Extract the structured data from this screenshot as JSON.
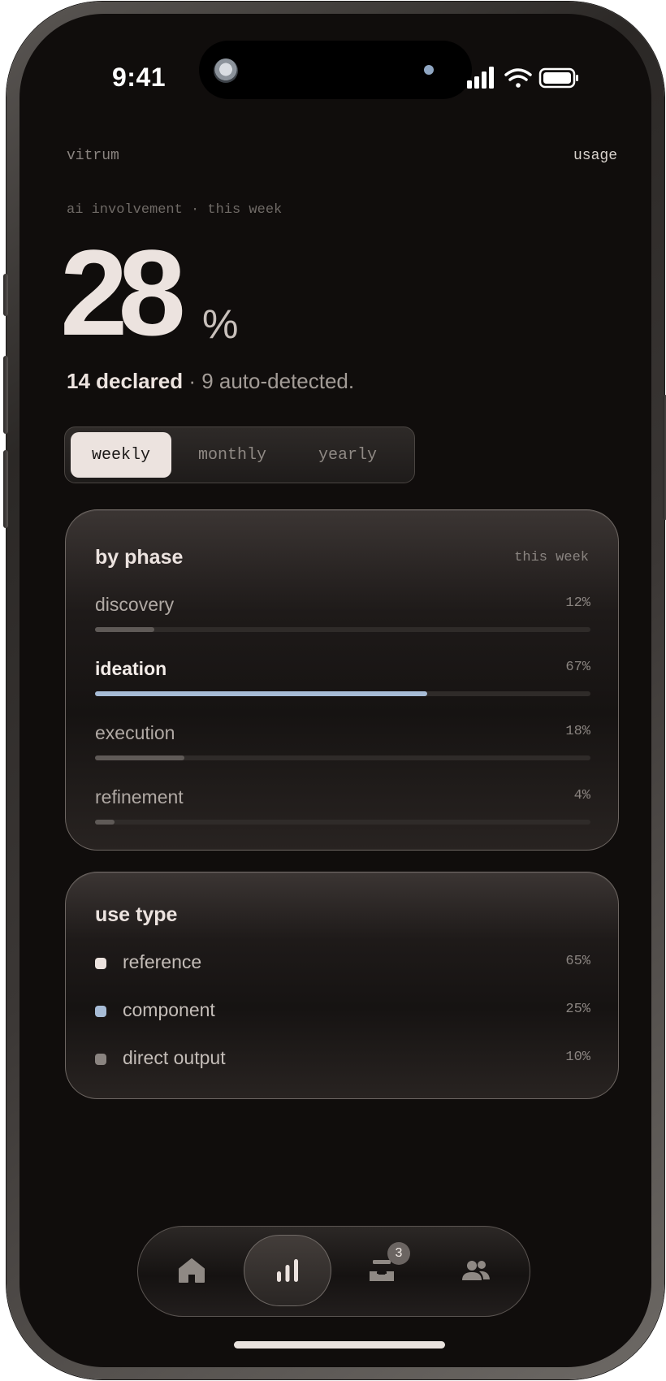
{
  "status_bar": {
    "time": "9:41"
  },
  "header": {
    "brand": "vitrum",
    "nav_link": "usage"
  },
  "hero": {
    "overline": "ai involvement · this week",
    "value": "28",
    "unit": "%",
    "declared": "14 declared",
    "rest": " · 9 auto-detected."
  },
  "period_tabs": {
    "options": [
      "weekly",
      "monthly",
      "yearly"
    ],
    "selected": "weekly"
  },
  "by_phase": {
    "title": "by phase",
    "meta": "this week",
    "items": [
      {
        "label": "discovery",
        "pct_text": "12%",
        "value": 12,
        "highlighted": false
      },
      {
        "label": "ideation",
        "pct_text": "67%",
        "value": 67,
        "highlighted": true
      },
      {
        "label": "execution",
        "pct_text": "18%",
        "value": 18,
        "highlighted": false
      },
      {
        "label": "refinement",
        "pct_text": "4%",
        "value": 4,
        "highlighted": false
      }
    ]
  },
  "use_type": {
    "title": "use type",
    "items": [
      {
        "label": "reference",
        "pct_text": "65%",
        "value": 65,
        "color": "#ece3df"
      },
      {
        "label": "component",
        "pct_text": "25%",
        "value": 25,
        "color": "#a7bcd6"
      },
      {
        "label": "direct output",
        "pct_text": "10%",
        "value": 10,
        "color": "#8a8480"
      }
    ]
  },
  "tabbar": {
    "items": [
      {
        "icon": "home-icon",
        "active": false
      },
      {
        "icon": "bar-chart-icon",
        "active": true
      },
      {
        "icon": "inbox-icon",
        "active": false,
        "badge": "3"
      },
      {
        "icon": "people-icon",
        "active": false
      }
    ]
  },
  "colors": {
    "background": "#100d0c",
    "accent": "#a7bcd6",
    "text_primary": "#ece3df"
  }
}
